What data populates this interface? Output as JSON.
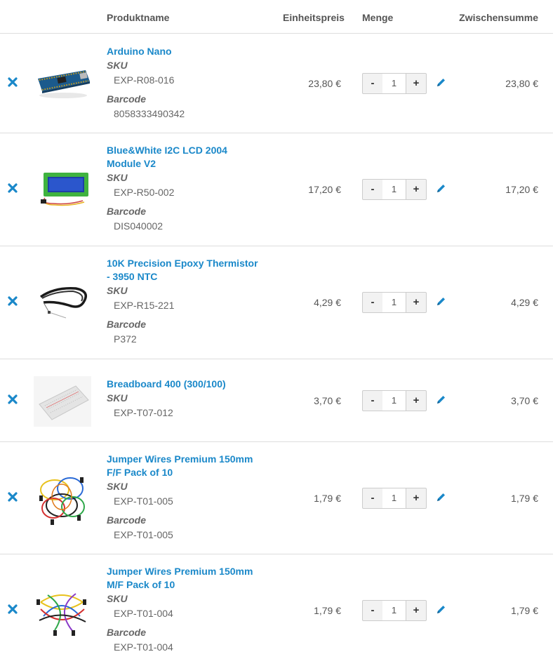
{
  "header": {
    "product_name": "Produktname",
    "unit_price": "Einheitspreis",
    "quantity": "Menge",
    "subtotal": "Zwischensumme"
  },
  "labels": {
    "sku": "SKU",
    "barcode": "Barcode"
  },
  "items": [
    {
      "name_line1": "Arduino Nano",
      "name_line2": "",
      "sku": "EXP-R08-016",
      "barcode": "8058333490342",
      "price": "23,80 €",
      "qty": "1",
      "subtotal": "23,80 €",
      "image_icon": "arduino-nano-image"
    },
    {
      "name_line1": "Blue&White I2C LCD 2004",
      "name_line2": "Module V2",
      "sku": "EXP-R50-002",
      "barcode": "DIS040002",
      "price": "17,20 €",
      "qty": "1",
      "subtotal": "17,20 €",
      "image_icon": "lcd-module-image"
    },
    {
      "name_line1": "10K Precision Epoxy Thermistor",
      "name_line2": "- 3950 NTC",
      "sku": "EXP-R15-221",
      "barcode": "P372",
      "price": "4,29 €",
      "qty": "1",
      "subtotal": "4,29 €",
      "image_icon": "thermistor-image"
    },
    {
      "name_line1": "Breadboard 400 (300/100)",
      "name_line2": "",
      "sku": "EXP-T07-012",
      "barcode": "",
      "price": "3,70 €",
      "qty": "1",
      "subtotal": "3,70 €",
      "image_icon": "breadboard-image"
    },
    {
      "name_line1": "Jumper Wires Premium 150mm",
      "name_line2": "F/F Pack of 10",
      "sku": "EXP-T01-005",
      "barcode": "EXP-T01-005",
      "price": "1,79 €",
      "qty": "1",
      "subtotal": "1,79 €",
      "image_icon": "jumper-wires-image"
    },
    {
      "name_line1": "Jumper Wires Premium 150mm",
      "name_line2": "M/F Pack of 10",
      "sku": "EXP-T01-004",
      "barcode": "EXP-T01-004",
      "price": "1,79 €",
      "qty": "1",
      "subtotal": "1,79 €",
      "image_icon": "jumper-wires-image"
    }
  ],
  "buttons": {
    "minus": "-",
    "plus": "+"
  },
  "colors": {
    "link": "#1a88c9",
    "border": "#dddddd"
  }
}
